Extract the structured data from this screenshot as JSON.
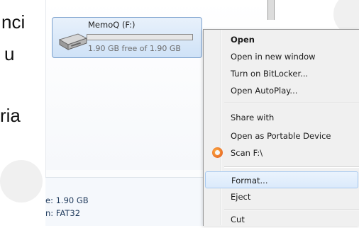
{
  "slide": {
    "line1": "nci",
    "line2": "u",
    "line3": "ria"
  },
  "drive": {
    "name": "MemoQ (F:)",
    "free_text": "1.90 GB free of 1.90 GB",
    "used_fraction": 0.0,
    "bar_color": "#26a0da",
    "icon": "usb-drive-icon"
  },
  "details": {
    "size_line": "e: 1.90 GB",
    "fs_line": "n: FAT32"
  },
  "context_menu": {
    "items": [
      {
        "label": "Open",
        "bold": true
      },
      {
        "label": "Open in new window"
      },
      {
        "label": "Turn on BitLocker..."
      },
      {
        "label": "Open AutoPlay..."
      },
      {
        "label": "Share with"
      },
      {
        "label": "Open as Portable Device"
      },
      {
        "label": "Scan F:\\",
        "icon": "antivirus-icon"
      },
      {
        "label": "Format...",
        "highlighted": true
      },
      {
        "label": "Eject"
      },
      {
        "label": "Cut"
      }
    ]
  }
}
